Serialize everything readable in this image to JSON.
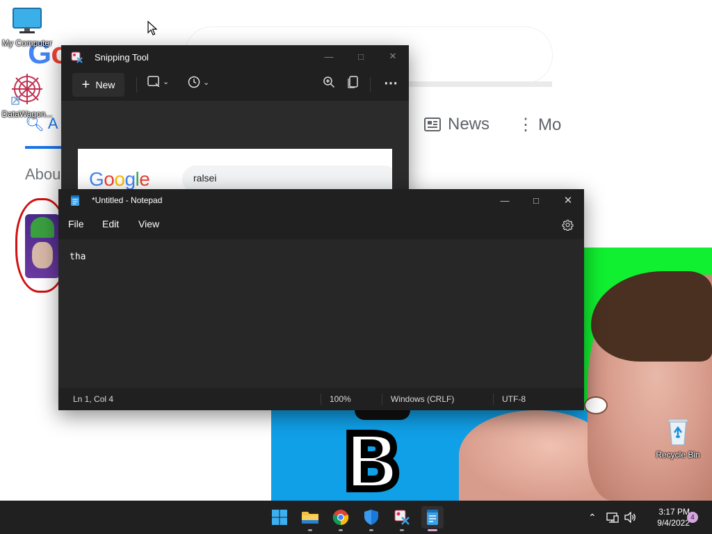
{
  "desktop": {
    "icons": [
      {
        "label": "My Computer",
        "icon": "monitor-icon"
      },
      {
        "label": "DataWagon...",
        "icon": "datawagon-icon"
      },
      {
        "label": "Recycle Bin",
        "icon": "recycle-bin-icon"
      }
    ]
  },
  "background_page": {
    "tabs": {
      "all": "A",
      "news": "News",
      "more": "Mo"
    },
    "about_text": "Abou"
  },
  "snipping_tool": {
    "title": "Snipping Tool",
    "new_label": "New",
    "preview": {
      "logo": "Google",
      "query": "ralsei"
    },
    "icons": {
      "app": "snipping-tool-icon",
      "new": "plus-icon",
      "mode": "rectangle-snip-icon",
      "delay": "clock-icon",
      "zoom": "zoom-in-icon",
      "pages": "page-icon",
      "more": "more-icon"
    }
  },
  "notepad": {
    "title": "*Untitled - Notepad",
    "menu": [
      "File",
      "Edit",
      "View"
    ],
    "content": "tha",
    "status": {
      "position": "Ln 1, Col 4",
      "zoom": "100%",
      "line_ending": "Windows (CRLF)",
      "encoding": "UTF-8"
    }
  },
  "taskbar": {
    "apps": [
      "start",
      "file-explorer",
      "chrome",
      "defender",
      "snipping-tool",
      "notepad"
    ],
    "active_app": "notepad",
    "clock": {
      "time": "3:17 PM",
      "date": "9/4/2022"
    },
    "notification_count": "4"
  },
  "colors": {
    "window_bg": "#202020",
    "editor_bg": "#272727",
    "accent": "#0078d4",
    "taskbar": "#202020"
  }
}
